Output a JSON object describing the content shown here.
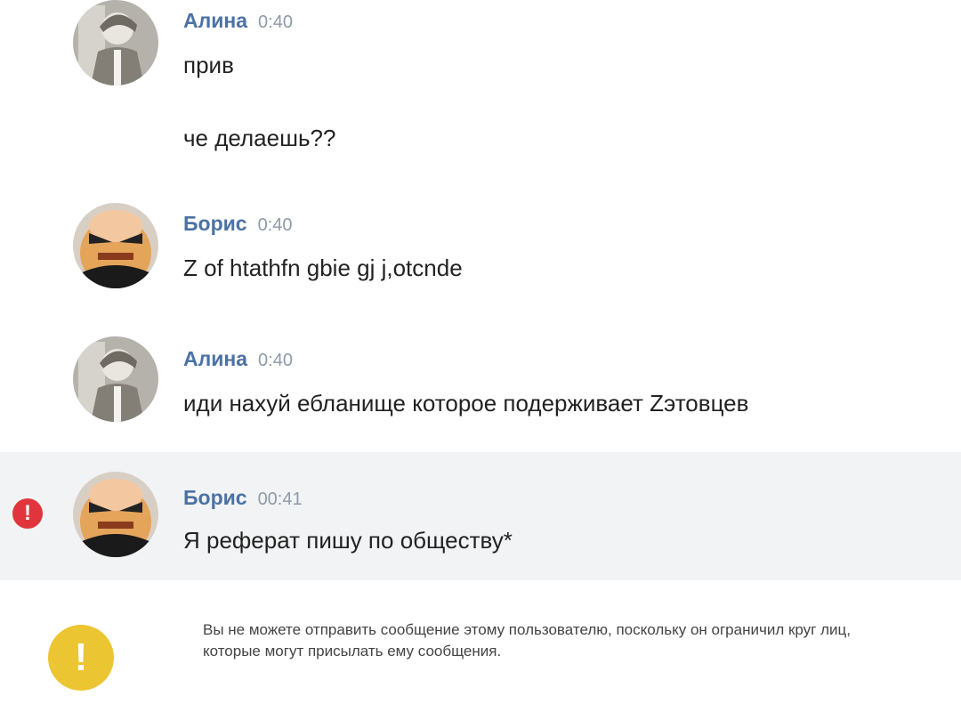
{
  "messages": [
    {
      "author": "Алина",
      "time": "0:40",
      "lines": [
        "прив",
        "че делаешь??"
      ]
    },
    {
      "author": "Борис",
      "time": "0:40",
      "lines": [
        "Z of htathfn gbie gj j,otcnde"
      ]
    },
    {
      "author": "Алина",
      "time": "0:40",
      "lines": [
        "иди нахуй ебланище которое подерживает Zэтовцев"
      ]
    },
    {
      "author": "Борис",
      "time": "00:41",
      "lines": [
        "Я реферат пишу по обществу*"
      ],
      "failed": true
    }
  ],
  "error_icon": {
    "symbol": "!",
    "color": "#e0353c"
  },
  "notice": {
    "icon": "!",
    "icon_color": "#ecc532",
    "text": "Вы не можете отправить сообщение этому пользователю, поскольку он ограничил круг лиц, которые могут присылать ему сообщения."
  }
}
